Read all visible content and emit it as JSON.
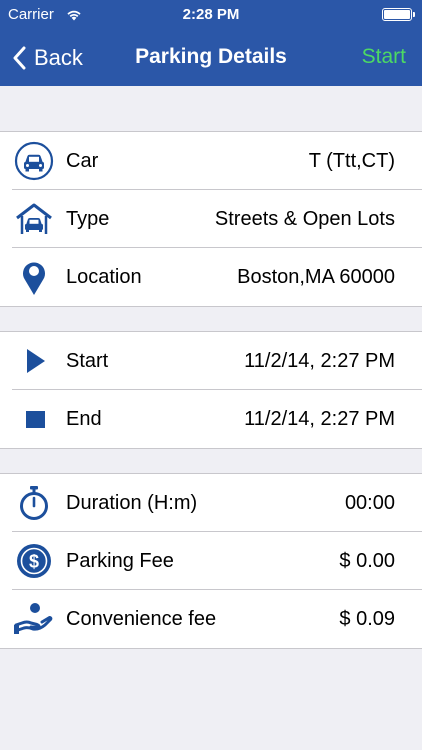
{
  "status_bar": {
    "carrier": "Carrier",
    "time": "2:28 PM"
  },
  "nav": {
    "back_label": "Back",
    "title": "Parking Details",
    "start_label": "Start"
  },
  "colors": {
    "nav_background": "#2b57a8",
    "start_action": "#4cd964",
    "icon_blue": "#1c4f9c"
  },
  "vehicle_section": [
    {
      "icon": "car-icon",
      "label": "Car",
      "value": "T (Ttt,CT)"
    },
    {
      "icon": "garage-icon",
      "label": "Type",
      "value": "Streets & Open Lots"
    },
    {
      "icon": "location-pin-icon",
      "label": "Location",
      "value": "Boston,MA 60000"
    }
  ],
  "time_section": [
    {
      "icon": "play-icon",
      "label": "Start",
      "value": "11/2/14, 2:27 PM"
    },
    {
      "icon": "stop-icon",
      "label": "End",
      "value": "11/2/14, 2:27 PM"
    }
  ],
  "fee_section": [
    {
      "icon": "stopwatch-icon",
      "label": "Duration (H:m)",
      "value": "00:00"
    },
    {
      "icon": "dollar-coin-icon",
      "label": "Parking Fee",
      "value": "$ 0.00"
    },
    {
      "icon": "hand-coin-icon",
      "label": "Convenience fee",
      "value": "$ 0.09"
    }
  ]
}
